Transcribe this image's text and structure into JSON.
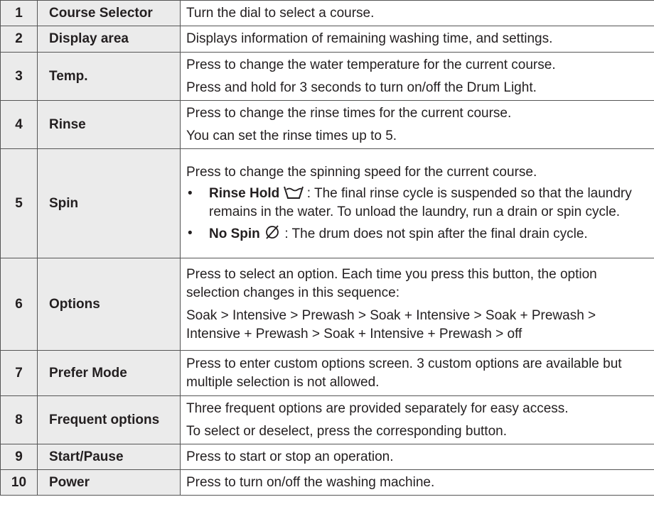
{
  "rows": [
    {
      "num": "1",
      "name": "Course Selector",
      "desc": [
        "Turn the dial to select a course."
      ]
    },
    {
      "num": "2",
      "name": "Display area",
      "desc": [
        "Displays information of remaining washing time, and settings."
      ]
    },
    {
      "num": "3",
      "name": "Temp.",
      "desc": [
        "Press to change the water temperature for the current course.",
        "Press and hold for 3 seconds to turn on/off the Drum Light."
      ]
    },
    {
      "num": "4",
      "name": "Rinse",
      "desc": [
        "Press to change the rinse times for the current course.",
        "You can set the rinse times up to 5."
      ]
    },
    {
      "num": "5",
      "name": "Spin",
      "desc": [
        "Press to change the spinning speed for the current course."
      ],
      "bullets": [
        {
          "bold": "Rinse Hold",
          "icon": "rinse-hold-icon",
          "text": " : The final rinse cycle is suspended so that the laundry remains in the water. To unload the laundry, run a drain or spin cycle."
        },
        {
          "bold": "No Spin",
          "icon": "no-spin-icon",
          "text": " : The drum does not spin after the final drain cycle."
        }
      ]
    },
    {
      "num": "6",
      "name": "Options",
      "desc": [
        "Press to select an option. Each time you press this button, the option selection changes in this sequence:",
        "Soak > Intensive > Prewash > Soak + Intensive > Soak + Prewash > Intensive + Prewash > Soak + Intensive + Prewash > off"
      ]
    },
    {
      "num": "7",
      "name": "Prefer Mode",
      "desc": [
        "Press to enter custom options screen. 3 custom options are available but multiple selection is not allowed."
      ]
    },
    {
      "num": "8",
      "name": "Frequent options",
      "desc": [
        "Three frequent options are provided separately for easy access.",
        "To select or deselect, press the corresponding button."
      ]
    },
    {
      "num": "9",
      "name": "Start/Pause",
      "desc": [
        "Press to start or stop an operation."
      ]
    },
    {
      "num": "10",
      "name": "Power",
      "desc": [
        "Press to turn on/off the washing machine."
      ]
    }
  ],
  "bullet_glyph": "•",
  "colors": {
    "header_bg": "#ebebeb",
    "border": "#555555",
    "text": "#231f20"
  }
}
